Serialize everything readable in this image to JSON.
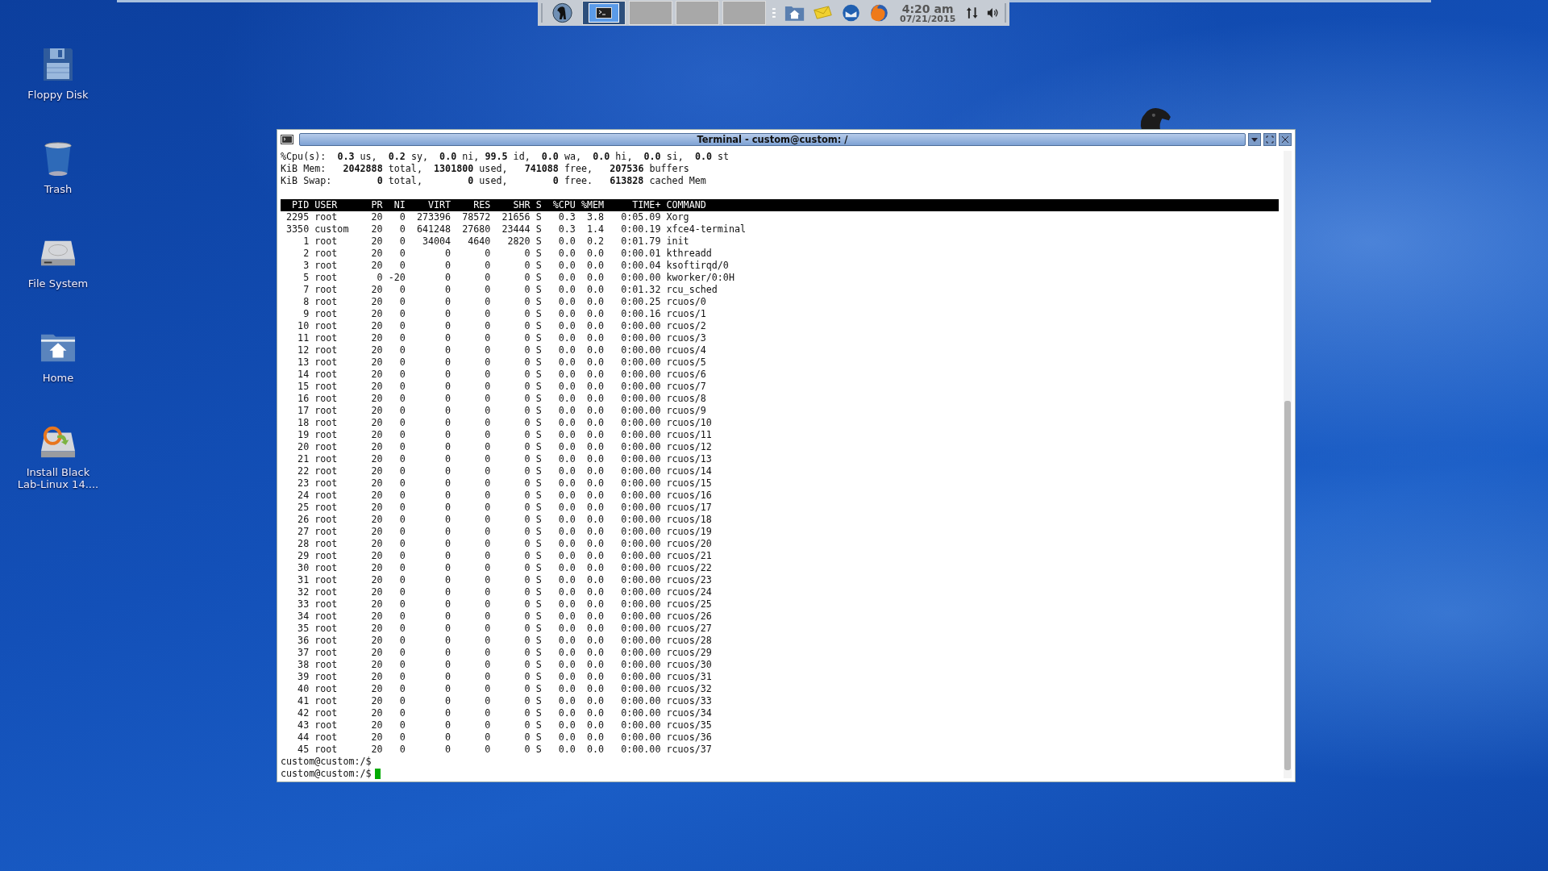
{
  "taskbar": {
    "tasks": [
      {
        "selected": true
      },
      {
        "selected": false
      },
      {
        "selected": false
      },
      {
        "selected": false
      }
    ],
    "clock": {
      "time": "4:20 am",
      "date": "07/21/2015"
    }
  },
  "desktop_icons": [
    {
      "kind": "floppy",
      "label": "Floppy Disk"
    },
    {
      "kind": "trash",
      "label": "Trash"
    },
    {
      "kind": "drive",
      "label": "File System"
    },
    {
      "kind": "home",
      "label": "Home"
    },
    {
      "kind": "installer",
      "label": "Install Black Lab-Linux 14...."
    }
  ],
  "terminal": {
    "title": "Terminal - custom@custom: /",
    "summary": [
      "%Cpu(s):  **0.3** us,  **0.2** sy,  **0.0** ni, **99.5** id,  **0.0** wa,  **0.0** hi,  **0.0** si,  **0.0** st",
      "KiB Mem:   **2042888** total,  **1301800** used,   **741088** free,   **207536** buffers",
      "KiB Swap:        **0** total,        **0** used,        **0** free.   **613828** cached Mem"
    ],
    "columns": [
      "PID",
      "USER",
      "PR",
      "NI",
      "VIRT",
      "RES",
      "SHR",
      "S",
      "%CPU",
      "%MEM",
      "TIME+",
      "COMMAND"
    ],
    "rows": [
      [
        "2295",
        "root",
        "20",
        "0",
        "273396",
        "78572",
        "21656",
        "S",
        "0.3",
        "3.8",
        "0:05.09",
        "Xorg"
      ],
      [
        "3350",
        "custom",
        "20",
        "0",
        "641248",
        "27680",
        "23444",
        "S",
        "0.3",
        "1.4",
        "0:00.19",
        "xfce4-terminal"
      ],
      [
        "1",
        "root",
        "20",
        "0",
        "34004",
        "4640",
        "2820",
        "S",
        "0.0",
        "0.2",
        "0:01.79",
        "init"
      ],
      [
        "2",
        "root",
        "20",
        "0",
        "0",
        "0",
        "0",
        "S",
        "0.0",
        "0.0",
        "0:00.01",
        "kthreadd"
      ],
      [
        "3",
        "root",
        "20",
        "0",
        "0",
        "0",
        "0",
        "S",
        "0.0",
        "0.0",
        "0:00.04",
        "ksoftirqd/0"
      ],
      [
        "5",
        "root",
        "0",
        "-20",
        "0",
        "0",
        "0",
        "S",
        "0.0",
        "0.0",
        "0:00.00",
        "kworker/0:0H"
      ],
      [
        "7",
        "root",
        "20",
        "0",
        "0",
        "0",
        "0",
        "S",
        "0.0",
        "0.0",
        "0:01.32",
        "rcu_sched"
      ],
      [
        "8",
        "root",
        "20",
        "0",
        "0",
        "0",
        "0",
        "S",
        "0.0",
        "0.0",
        "0:00.25",
        "rcuos/0"
      ],
      [
        "9",
        "root",
        "20",
        "0",
        "0",
        "0",
        "0",
        "S",
        "0.0",
        "0.0",
        "0:00.16",
        "rcuos/1"
      ],
      [
        "10",
        "root",
        "20",
        "0",
        "0",
        "0",
        "0",
        "S",
        "0.0",
        "0.0",
        "0:00.00",
        "rcuos/2"
      ],
      [
        "11",
        "root",
        "20",
        "0",
        "0",
        "0",
        "0",
        "S",
        "0.0",
        "0.0",
        "0:00.00",
        "rcuos/3"
      ],
      [
        "12",
        "root",
        "20",
        "0",
        "0",
        "0",
        "0",
        "S",
        "0.0",
        "0.0",
        "0:00.00",
        "rcuos/4"
      ],
      [
        "13",
        "root",
        "20",
        "0",
        "0",
        "0",
        "0",
        "S",
        "0.0",
        "0.0",
        "0:00.00",
        "rcuos/5"
      ],
      [
        "14",
        "root",
        "20",
        "0",
        "0",
        "0",
        "0",
        "S",
        "0.0",
        "0.0",
        "0:00.00",
        "rcuos/6"
      ],
      [
        "15",
        "root",
        "20",
        "0",
        "0",
        "0",
        "0",
        "S",
        "0.0",
        "0.0",
        "0:00.00",
        "rcuos/7"
      ],
      [
        "16",
        "root",
        "20",
        "0",
        "0",
        "0",
        "0",
        "S",
        "0.0",
        "0.0",
        "0:00.00",
        "rcuos/8"
      ],
      [
        "17",
        "root",
        "20",
        "0",
        "0",
        "0",
        "0",
        "S",
        "0.0",
        "0.0",
        "0:00.00",
        "rcuos/9"
      ],
      [
        "18",
        "root",
        "20",
        "0",
        "0",
        "0",
        "0",
        "S",
        "0.0",
        "0.0",
        "0:00.00",
        "rcuos/10"
      ],
      [
        "19",
        "root",
        "20",
        "0",
        "0",
        "0",
        "0",
        "S",
        "0.0",
        "0.0",
        "0:00.00",
        "rcuos/11"
      ],
      [
        "20",
        "root",
        "20",
        "0",
        "0",
        "0",
        "0",
        "S",
        "0.0",
        "0.0",
        "0:00.00",
        "rcuos/12"
      ],
      [
        "21",
        "root",
        "20",
        "0",
        "0",
        "0",
        "0",
        "S",
        "0.0",
        "0.0",
        "0:00.00",
        "rcuos/13"
      ],
      [
        "22",
        "root",
        "20",
        "0",
        "0",
        "0",
        "0",
        "S",
        "0.0",
        "0.0",
        "0:00.00",
        "rcuos/14"
      ],
      [
        "23",
        "root",
        "20",
        "0",
        "0",
        "0",
        "0",
        "S",
        "0.0",
        "0.0",
        "0:00.00",
        "rcuos/15"
      ],
      [
        "24",
        "root",
        "20",
        "0",
        "0",
        "0",
        "0",
        "S",
        "0.0",
        "0.0",
        "0:00.00",
        "rcuos/16"
      ],
      [
        "25",
        "root",
        "20",
        "0",
        "0",
        "0",
        "0",
        "S",
        "0.0",
        "0.0",
        "0:00.00",
        "rcuos/17"
      ],
      [
        "26",
        "root",
        "20",
        "0",
        "0",
        "0",
        "0",
        "S",
        "0.0",
        "0.0",
        "0:00.00",
        "rcuos/18"
      ],
      [
        "27",
        "root",
        "20",
        "0",
        "0",
        "0",
        "0",
        "S",
        "0.0",
        "0.0",
        "0:00.00",
        "rcuos/19"
      ],
      [
        "28",
        "root",
        "20",
        "0",
        "0",
        "0",
        "0",
        "S",
        "0.0",
        "0.0",
        "0:00.00",
        "rcuos/20"
      ],
      [
        "29",
        "root",
        "20",
        "0",
        "0",
        "0",
        "0",
        "S",
        "0.0",
        "0.0",
        "0:00.00",
        "rcuos/21"
      ],
      [
        "30",
        "root",
        "20",
        "0",
        "0",
        "0",
        "0",
        "S",
        "0.0",
        "0.0",
        "0:00.00",
        "rcuos/22"
      ],
      [
        "31",
        "root",
        "20",
        "0",
        "0",
        "0",
        "0",
        "S",
        "0.0",
        "0.0",
        "0:00.00",
        "rcuos/23"
      ],
      [
        "32",
        "root",
        "20",
        "0",
        "0",
        "0",
        "0",
        "S",
        "0.0",
        "0.0",
        "0:00.00",
        "rcuos/24"
      ],
      [
        "33",
        "root",
        "20",
        "0",
        "0",
        "0",
        "0",
        "S",
        "0.0",
        "0.0",
        "0:00.00",
        "rcuos/25"
      ],
      [
        "34",
        "root",
        "20",
        "0",
        "0",
        "0",
        "0",
        "S",
        "0.0",
        "0.0",
        "0:00.00",
        "rcuos/26"
      ],
      [
        "35",
        "root",
        "20",
        "0",
        "0",
        "0",
        "0",
        "S",
        "0.0",
        "0.0",
        "0:00.00",
        "rcuos/27"
      ],
      [
        "36",
        "root",
        "20",
        "0",
        "0",
        "0",
        "0",
        "S",
        "0.0",
        "0.0",
        "0:00.00",
        "rcuos/28"
      ],
      [
        "37",
        "root",
        "20",
        "0",
        "0",
        "0",
        "0",
        "S",
        "0.0",
        "0.0",
        "0:00.00",
        "rcuos/29"
      ],
      [
        "38",
        "root",
        "20",
        "0",
        "0",
        "0",
        "0",
        "S",
        "0.0",
        "0.0",
        "0:00.00",
        "rcuos/30"
      ],
      [
        "39",
        "root",
        "20",
        "0",
        "0",
        "0",
        "0",
        "S",
        "0.0",
        "0.0",
        "0:00.00",
        "rcuos/31"
      ],
      [
        "40",
        "root",
        "20",
        "0",
        "0",
        "0",
        "0",
        "S",
        "0.0",
        "0.0",
        "0:00.00",
        "rcuos/32"
      ],
      [
        "41",
        "root",
        "20",
        "0",
        "0",
        "0",
        "0",
        "S",
        "0.0",
        "0.0",
        "0:00.00",
        "rcuos/33"
      ],
      [
        "42",
        "root",
        "20",
        "0",
        "0",
        "0",
        "0",
        "S",
        "0.0",
        "0.0",
        "0:00.00",
        "rcuos/34"
      ],
      [
        "43",
        "root",
        "20",
        "0",
        "0",
        "0",
        "0",
        "S",
        "0.0",
        "0.0",
        "0:00.00",
        "rcuos/35"
      ],
      [
        "44",
        "root",
        "20",
        "0",
        "0",
        "0",
        "0",
        "S",
        "0.0",
        "0.0",
        "0:00.00",
        "rcuos/36"
      ],
      [
        "45",
        "root",
        "20",
        "0",
        "0",
        "0",
        "0",
        "S",
        "0.0",
        "0.0",
        "0:00.00",
        "rcuos/37"
      ]
    ],
    "prompts": [
      "custom@custom:/$",
      "custom@custom:/$"
    ]
  }
}
